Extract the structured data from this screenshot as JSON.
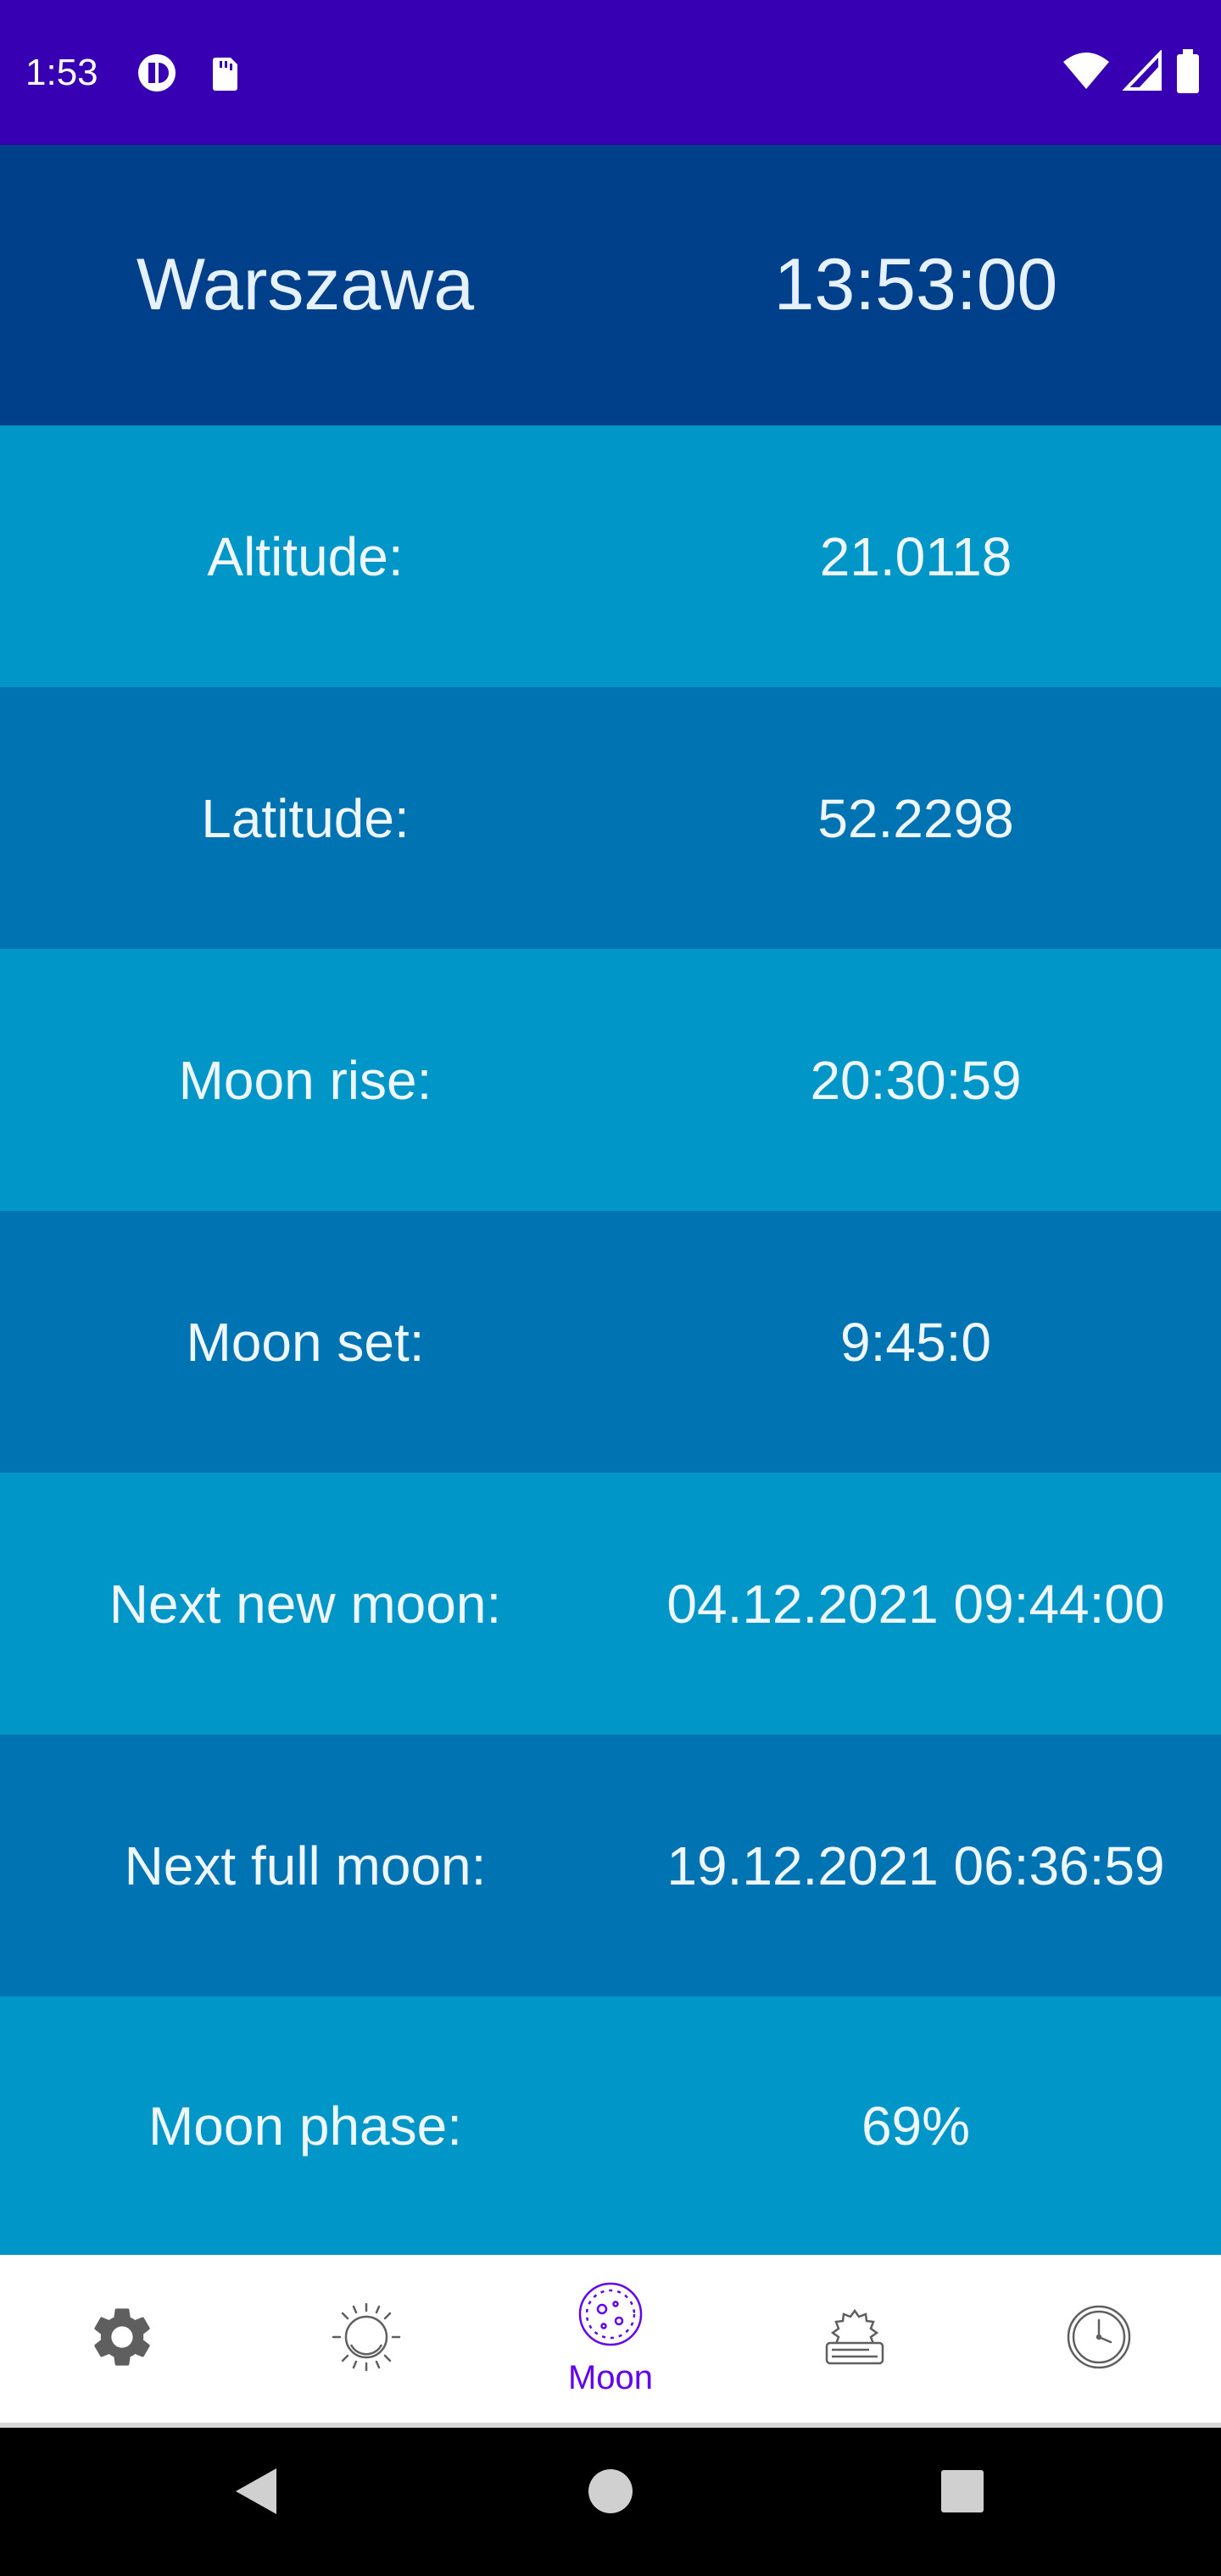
{
  "status_bar": {
    "time": "1:53",
    "icons": [
      "app-notification-icon",
      "sd-card-icon",
      "wifi-icon",
      "cell-signal-icon",
      "battery-icon"
    ],
    "background": "#3700b3"
  },
  "header": {
    "city": "Warszawa",
    "clock": "13:53:00",
    "background": "#003f8a"
  },
  "rows": [
    {
      "label": "Altitude:",
      "value": "21.0118",
      "background": "#0096c7"
    },
    {
      "label": "Latitude:",
      "value": "52.2298",
      "background": "#0073b3"
    },
    {
      "label": "Moon rise:",
      "value": "20:30:59",
      "background": "#0096c7"
    },
    {
      "label": "Moon set:",
      "value": "9:45:0",
      "background": "#0073b3"
    },
    {
      "label": "Next new moon:",
      "value": "04.12.2021 09:44:00",
      "background": "#0096c7"
    },
    {
      "label": "Next full moon:",
      "value": "19.12.2021 06:36:59",
      "background": "#0073b3"
    },
    {
      "label": "Moon phase:",
      "value": "69%",
      "background": "#0096c7"
    }
  ],
  "bottom_nav": {
    "active_color": "#6200ee",
    "items": [
      {
        "icon": "gear-icon",
        "label": ""
      },
      {
        "icon": "sun-icon",
        "label": ""
      },
      {
        "icon": "moon-icon",
        "label": "Moon"
      },
      {
        "icon": "weather-icon",
        "label": ""
      },
      {
        "icon": "clock-icon",
        "label": ""
      }
    ]
  },
  "system_nav": {
    "icons": [
      "back-icon",
      "home-icon",
      "recents-icon"
    ]
  }
}
